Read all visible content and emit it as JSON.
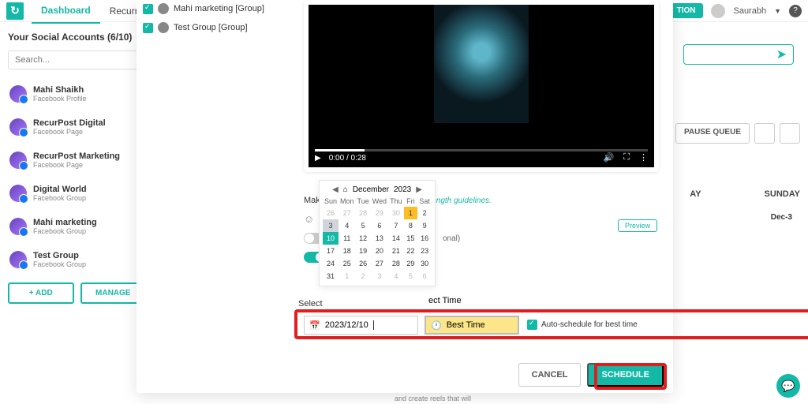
{
  "nav": {
    "tabs": [
      "Dashboard",
      "Recurring P"
    ],
    "button": "TION",
    "user": "Saurabh"
  },
  "sidebar": {
    "title": "Your Social Accounts (6/10)",
    "search_ph": "Search...",
    "accounts": [
      {
        "name": "Mahi Shaikh",
        "sub": "Facebook Profile"
      },
      {
        "name": "RecurPost Digital",
        "sub": "Facebook Page"
      },
      {
        "name": "RecurPost Marketing",
        "sub": "Facebook Page"
      },
      {
        "name": "Digital World",
        "sub": "Facebook Group"
      },
      {
        "name": "Mahi marketing",
        "sub": "Facebook Group"
      },
      {
        "name": "Test Group",
        "sub": "Facebook Group"
      }
    ],
    "add": "+  ADD",
    "manage": "MANAGE"
  },
  "right": {
    "pause": "PAUSE QUEUE",
    "days": [
      "AY",
      "SUNDAY"
    ],
    "date": "Dec-3"
  },
  "modal": {
    "groups": [
      {
        "label": "Mahi marketing [Group]"
      },
      {
        "label": "Test Group [Group]"
      }
    ],
    "video_time": "0:00 / 0:28",
    "make": "Make",
    "guidelines": "length guidelines.",
    "toggle2_label": "onal)",
    "preview": "Preview",
    "select_date": "Select",
    "select_time": "ect Time",
    "date_value": "2023/12/10",
    "time_value": "Best Time",
    "auto_label": "Auto-schedule for best time",
    "cancel": "CANCEL",
    "schedule": "SCHEDULE"
  },
  "calendar": {
    "month": "December",
    "year": "2023",
    "dow": [
      "Sun",
      "Mon",
      "Tue",
      "Wed",
      "Thu",
      "Fri",
      "Sat"
    ],
    "grid": [
      [
        26,
        27,
        28,
        29,
        30,
        1,
        2
      ],
      [
        3,
        4,
        5,
        6,
        7,
        8,
        9
      ],
      [
        10,
        11,
        12,
        13,
        14,
        15,
        16
      ],
      [
        17,
        18,
        19,
        20,
        21,
        22,
        23
      ],
      [
        24,
        25,
        26,
        27,
        28,
        29,
        30
      ],
      [
        31,
        1,
        2,
        3,
        4,
        5,
        6
      ]
    ]
  },
  "footer_hint": "and create reels that will"
}
